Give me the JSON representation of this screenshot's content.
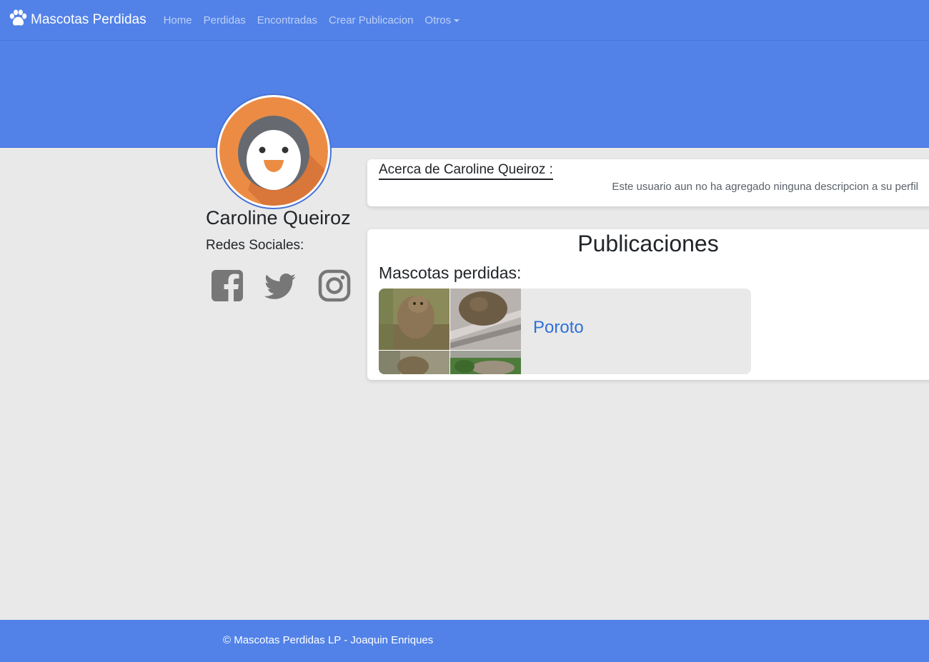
{
  "navbar": {
    "brand": "Mascotas Perdidas",
    "brand_icon": "paw-icon",
    "links": [
      "Home",
      "Perdidas",
      "Encontradas",
      "Crear Publicacion"
    ],
    "dropdown": "Otros"
  },
  "profile": {
    "avatar_icon": "penguin-avatar",
    "name": "Caroline Queiroz",
    "social_label": "Redes Sociales:",
    "social_icons": [
      "facebook-icon",
      "twitter-icon",
      "instagram-icon"
    ]
  },
  "about": {
    "title": "Acerca de Caroline Queiroz :",
    "description": "Este usuario aun no ha agregado ninguna descripcion a su perfil"
  },
  "publications": {
    "title": "Publicaciones",
    "lost_label": "Mascotas perdidas:",
    "items": [
      {
        "name": "Poroto",
        "photos": [
          "cat-photo-1",
          "cat-photo-2",
          "cat-photo-3",
          "cat-photo-4"
        ]
      }
    ]
  },
  "footer": {
    "text": "© Mascotas Perdidas LP - Joaquin Enriques"
  },
  "colors": {
    "primary": "#5282e8",
    "background": "#e9e9e9",
    "link": "#2f70d8",
    "avatar_orange": "#ec8c44"
  }
}
